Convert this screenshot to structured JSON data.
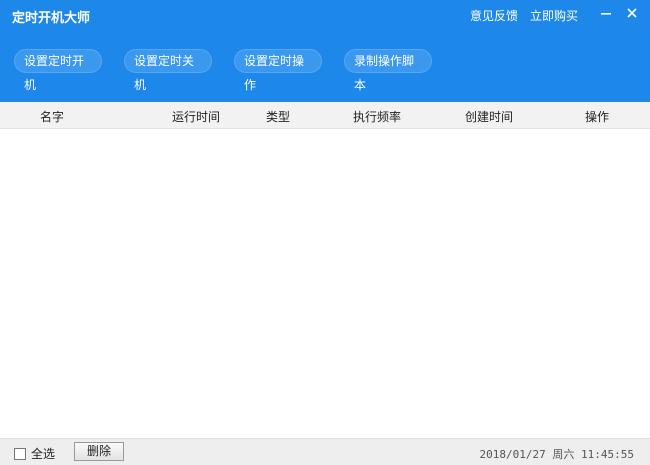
{
  "app": {
    "title": "定时开机大师",
    "links": [
      "意见反馈",
      "立即购买"
    ]
  },
  "toolbar": {
    "buttons": [
      "设置定时开机",
      "设置定时关机",
      "设置定时操作",
      "录制操作脚本"
    ]
  },
  "table": {
    "columns": [
      "名字",
      "运行时间",
      "类型",
      "执行频率",
      "创建时间",
      "操作"
    ],
    "rows": []
  },
  "footer": {
    "select_all_label": "全选",
    "select_all_checked": false,
    "delete_label": "删除",
    "datetime": "2018/01/27 周六 11:45:55"
  },
  "colors": {
    "header": "#1e88ea",
    "button": "#3b98ef",
    "table_header": "#f2f2f2"
  },
  "icons": {
    "minimize": "minimize-icon",
    "close": "close-icon"
  }
}
